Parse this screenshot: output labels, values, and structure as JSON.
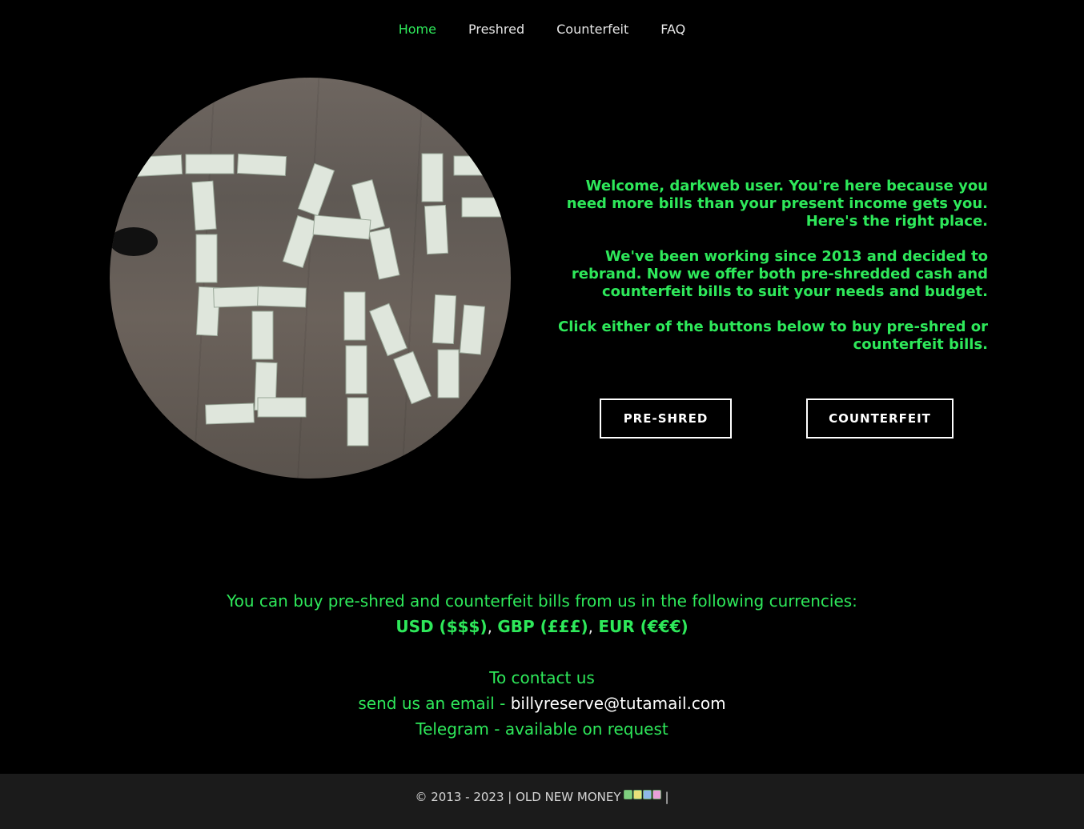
{
  "nav": {
    "items": [
      {
        "label": "Home",
        "active": true
      },
      {
        "label": "Preshred",
        "active": false
      },
      {
        "label": "Counterfeit",
        "active": false
      },
      {
        "label": "FAQ",
        "active": false
      }
    ]
  },
  "hero": {
    "paragraphs": [
      "Welcome, darkweb user. You're here because you need more bills than your present income gets you. Here's the right place.",
      "We've been working since 2013 and decided to rebrand. Now we offer both pre-shredded cash and counterfeit bills to suit your needs and budget.",
      "Click either of the buttons below to buy pre-shred or counterfeit bills."
    ],
    "buttons": {
      "preshred": "PRE-SHRED",
      "counterfeit": "COUNTERFEIT"
    }
  },
  "info": {
    "currencies_intro": "You can buy pre-shred and counterfeit bills from us in the following currencies:",
    "currencies": [
      "USD ($$$)",
      "GBP (£££)",
      "EUR (€€€)"
    ],
    "separator": ",",
    "contact_heading": "To contact us",
    "email_prefix": "send us an email -",
    "email": "billyreserve@tutamail.com",
    "telegram": "Telegram - available on request"
  },
  "footer": {
    "text": "© 2013 - 2023 | OLD NEW MONEY",
    "trail": "|"
  },
  "colors": {
    "accent": "#2ee85a",
    "background": "#000000",
    "footer_bg": "#1b1b1b"
  },
  "icons": {
    "footer_emoji": "money-bills-icon"
  }
}
